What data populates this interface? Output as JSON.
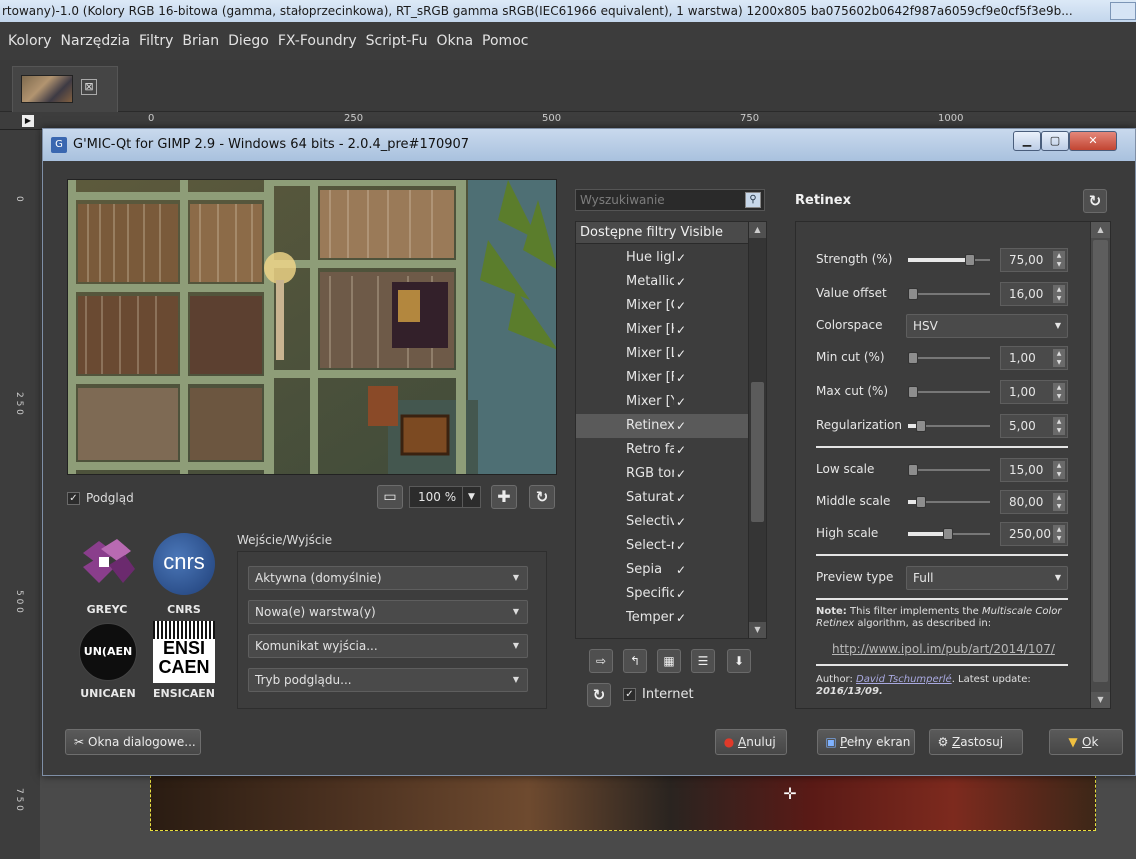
{
  "gimp": {
    "title": "rtowany)-1.0 (Kolory RGB 16-bitowa (gamma, stałoprzecinkowa), RT_sRGB gamma sRGB(IEC61966 equivalent), 1 warstwa) 1200x805 ba075602b0642f987a6059cf9e0cf5f3e9b...",
    "menu": [
      "Kolory",
      "Narzędzia",
      "Filtry",
      "Brian",
      "Diego",
      "FX-Foundry",
      "Script-Fu",
      "Okna",
      "Pomoc"
    ],
    "ruler": [
      "0",
      "250",
      "500",
      "750",
      "1000"
    ],
    "vruler": [
      "0",
      "2 5 0",
      "5 0 0",
      "7 5 0"
    ],
    "tab_close": "⊠"
  },
  "dialog": {
    "title": "G'MIC-Qt for GIMP 2.9 - Windows 64 bits - 2.0.4_pre#170907",
    "app_icon": "G",
    "preview_label": "Podgląd",
    "preview_checked": "✓",
    "zoom": "100 %",
    "logos": {
      "greyc": "GREYC",
      "cnrs": "CNRS",
      "unicaen": "UNICAEN",
      "ensicaen": "ENSICAEN",
      "cnrs_mark": "cnrs",
      "unicaen_mark": "UN(AEN",
      "ensi": "ENSI",
      "caen": "CAEN"
    },
    "io": {
      "title": "Wejście/Wyjście",
      "input": "Aktywna (domyślnie)",
      "output": "Nowa(e) warstwa(y)",
      "messages": "Komunikat wyjścia...",
      "preview_mode": "Tryb podglądu..."
    },
    "filters": {
      "search_placeholder": "Wyszukiwanie",
      "header": "Dostępne filtry Visible",
      "items": [
        {
          "name": "Hue ligh",
          "check": "✓"
        },
        {
          "name": "Metallic",
          "check": "✓"
        },
        {
          "name": "Mixer [C",
          "check": "✓"
        },
        {
          "name": "Mixer [H",
          "check": "✓"
        },
        {
          "name": "Mixer [L",
          "check": "✓"
        },
        {
          "name": "Mixer [F",
          "check": "✓"
        },
        {
          "name": "Mixer [Y",
          "check": "✓"
        },
        {
          "name": "Retinex",
          "check": "✓"
        },
        {
          "name": "Retro fa",
          "check": "✓"
        },
        {
          "name": "RGB tor",
          "check": "✓"
        },
        {
          "name": "Saturat",
          "check": "✓"
        },
        {
          "name": "Selectiv",
          "check": "✓"
        },
        {
          "name": "Select-r",
          "check": "✓"
        },
        {
          "name": "Sepia",
          "check": "✓"
        },
        {
          "name": "Specific",
          "check": "✓"
        },
        {
          "name": "Temper",
          "check": "✓"
        }
      ],
      "selected_index": 7,
      "internet_label": "Internet",
      "internet_checked": "✓"
    },
    "params": {
      "title": "Retinex",
      "strength": {
        "label": "Strength (%)",
        "value": "75,00",
        "min": 0,
        "max": 100,
        "v": 75
      },
      "value_offset": {
        "label": "Value offset",
        "value": "16,00",
        "min": 0,
        "max": 255,
        "v": 16
      },
      "colorspace": {
        "label": "Colorspace",
        "value": "HSV"
      },
      "min_cut": {
        "label": "Min cut (%)",
        "value": "1,00",
        "min": 0,
        "max": 100,
        "v": 1
      },
      "max_cut": {
        "label": "Max cut (%)",
        "value": "1,00",
        "min": 0,
        "max": 100,
        "v": 1
      },
      "regularization": {
        "label": "Regularization",
        "value": "5,00",
        "min": 0,
        "max": 32,
        "v": 5
      },
      "low_scale": {
        "label": "Low scale",
        "value": "15,00",
        "min": 0,
        "max": 256,
        "v": 15
      },
      "middle_scale": {
        "label": "Middle scale",
        "value": "80,00",
        "min": 0,
        "max": 512,
        "v": 80
      },
      "high_scale": {
        "label": "High scale",
        "value": "250,00",
        "min": 0,
        "max": 512,
        "v": 250
      },
      "preview_type": {
        "label": "Preview type",
        "value": "Full"
      },
      "note_bold": "Note:",
      "note_1": " This filter implements the ",
      "note_italic": "Multiscale Color Retinex",
      "note_2": " algorithm, as described in:",
      "link": "http://www.ipol.im/pub/art/2014/107/",
      "author_label": "Author: ",
      "author_name": "David Tschumperlé",
      "author_mid": ". Latest update: ",
      "author_date": "2016/13/09."
    },
    "buttons": {
      "dialogs": "Okna dialogowe...",
      "cancel_u": "A",
      "cancel_rest": "nuluj",
      "fullscreen_u": "P",
      "fullscreen_rest": "ełny ekran",
      "apply_u": "Z",
      "apply_rest": "astosuj",
      "ok_u": "O",
      "ok_rest": "k"
    }
  }
}
